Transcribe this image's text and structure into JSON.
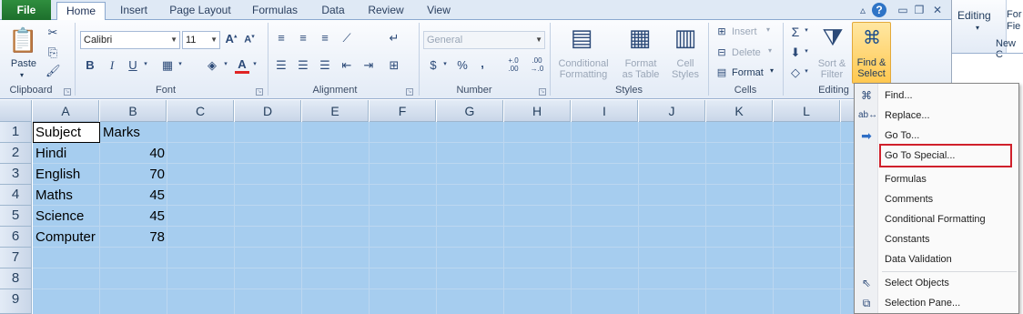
{
  "tabs": {
    "file": "File",
    "home": "Home",
    "insert": "Insert",
    "page_layout": "Page Layout",
    "formulas": "Formulas",
    "data": "Data",
    "review": "Review",
    "view": "View"
  },
  "window_controls": {
    "help": "?"
  },
  "right_window": {
    "editing": "Editing",
    "new_cut": "New C",
    "for_cut": "For",
    "fie_cut": "Fie"
  },
  "ribbon": {
    "clipboard": {
      "label": "Clipboard",
      "paste": "Paste"
    },
    "font": {
      "label": "Font",
      "font_name": "Calibri",
      "font_size": "11"
    },
    "alignment": {
      "label": "Alignment"
    },
    "number": {
      "label": "Number",
      "format": "General",
      "dollar": "$",
      "percent": "%",
      "comma": ",",
      "inc_dec": "+.0 .00",
      "dec_dec": ".00 →.0"
    },
    "styles": {
      "label": "Styles",
      "conditional": "Conditional",
      "formatting": "Formatting",
      "format_as": "Format",
      "as_table": "as Table",
      "cell": "Cell",
      "cell_styles": "Styles"
    },
    "cells": {
      "label": "Cells",
      "insert": "Insert",
      "delete": "Delete",
      "format": "Format"
    },
    "editing": {
      "label": "Editing",
      "sum": "Σ",
      "sort": "Sort &",
      "filter": "Filter",
      "find": "Find &",
      "select": "Select"
    }
  },
  "sheet": {
    "columns": [
      "A",
      "B",
      "C",
      "D",
      "E",
      "F",
      "G",
      "H",
      "I",
      "J",
      "K",
      "L"
    ],
    "rows": [
      "1",
      "2",
      "3",
      "4",
      "5",
      "6",
      "7",
      "8",
      "9"
    ],
    "data": [
      [
        "Subject",
        "Marks"
      ],
      [
        "Hindi",
        "40"
      ],
      [
        "English",
        "70"
      ],
      [
        "Maths",
        "45"
      ],
      [
        "Science",
        "45"
      ],
      [
        "Computer",
        "78"
      ]
    ]
  },
  "menu": {
    "find": "Find...",
    "replace": "Replace...",
    "goto": "Go To...",
    "goto_special": "Go To Special...",
    "formulas": "Formulas",
    "comments": "Comments",
    "conditional_formatting": "Conditional Formatting",
    "constants": "Constants",
    "data_validation": "Data Validation",
    "select_objects": "Select Objects",
    "selection_pane": "Selection Pane..."
  },
  "colors": {
    "selection": "#a6cdef",
    "highlight_box": "#d0202b",
    "file_tab": "#1d6f2c"
  }
}
